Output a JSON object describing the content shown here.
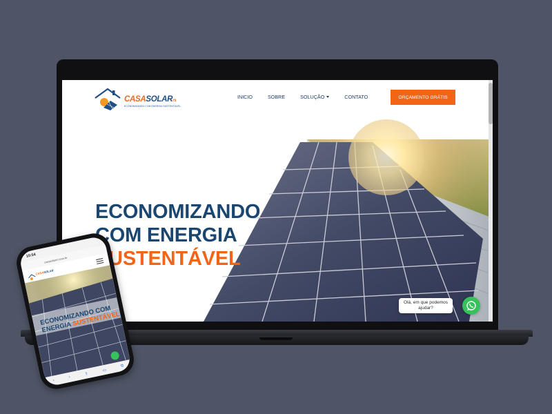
{
  "site": {
    "logo": {
      "part1": "CASA",
      "part2": "SOLAR",
      "suffix": "rs",
      "tagline": "ECONOMIZANDO COM ENERGIA SUSTENTÁVEL"
    },
    "nav": {
      "items": [
        {
          "label": "INICIO",
          "icon": null
        },
        {
          "label": "SOBRE",
          "icon": null
        },
        {
          "label": "SOLUÇÃO",
          "icon": "chevron-down-icon"
        },
        {
          "label": "CONTATO",
          "icon": null
        }
      ],
      "cta": "ORÇAMENTO GRÁTIS"
    },
    "hero": {
      "line1": "ECONOMIZANDO",
      "line2": "COM ENERGIA",
      "line3": "SUSTENTÁVEL"
    },
    "chat": {
      "line1": "Olá, em que podemos",
      "line2": "ajudar?",
      "icon": "whatsapp-icon"
    }
  },
  "phone": {
    "time": "10:54",
    "url": "casasolarrs.com.br",
    "headline_line1": "ECONOMIZANDO COM",
    "headline_line2_a": "ENERGIA ",
    "headline_line2_b": "SUSTENTÁVEL"
  },
  "colors": {
    "background": "#4f5566",
    "brand_blue": "#1a466f",
    "brand_orange": "#f26416",
    "whatsapp_green": "#35c25a"
  }
}
